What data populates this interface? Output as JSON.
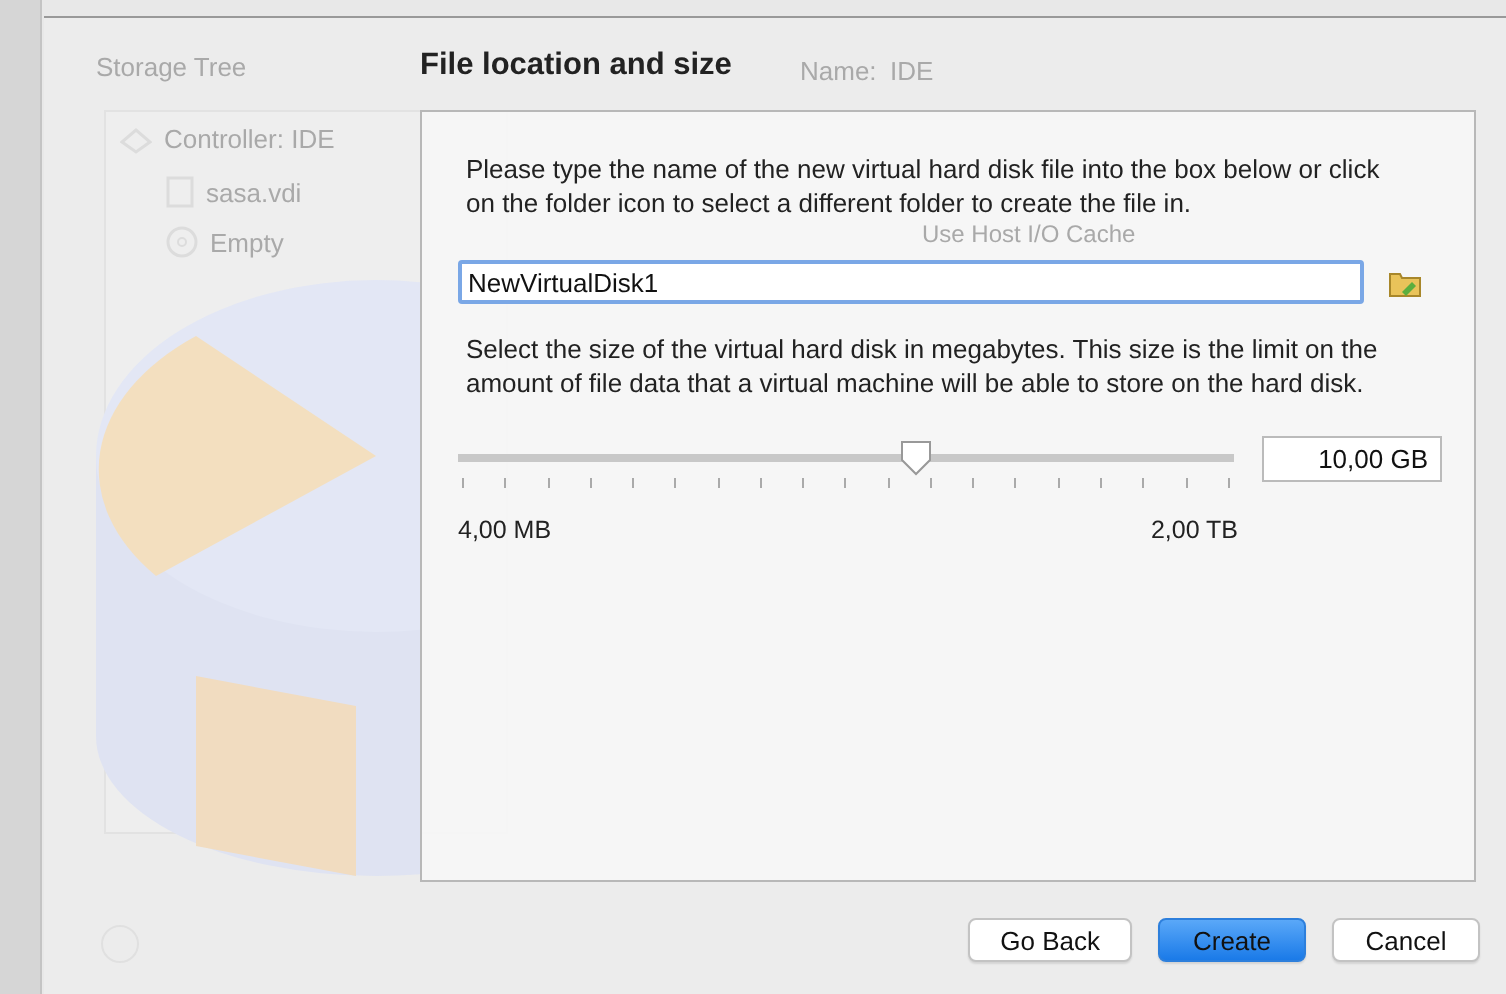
{
  "background_window": {
    "storage_tree_label": "Storage Tree",
    "tree_items": [
      {
        "label": "Controller: IDE",
        "kind": "controller"
      },
      {
        "label": "sasa.vdi",
        "kind": "disk"
      },
      {
        "label": "Empty",
        "kind": "optical"
      }
    ],
    "name_label": "Name:",
    "name_value": "IDE",
    "option": "Use Host I/O Cache"
  },
  "page_title": "File location and size",
  "location_hint": "Please type the name of the new virtual hard disk file into the box below or click on the folder icon to select a different folder to create the file in.",
  "file_name": "NewVirtualDisk1",
  "size_hint": "Select the size of the virtual hard disk in megabytes. This size is the limit on the amount of file data that a virtual machine will be able to store on the hard disk.",
  "size_slider": {
    "level": 0.59,
    "min_label": "4,00 MB",
    "max_label": "2,00 TB"
  },
  "size_value": "10,00 GB",
  "buttons": [
    {
      "label": "Go Back",
      "kind": "normal"
    },
    {
      "label": "Create",
      "kind": "default"
    },
    {
      "label": "Cancel",
      "kind": "normal"
    }
  ]
}
